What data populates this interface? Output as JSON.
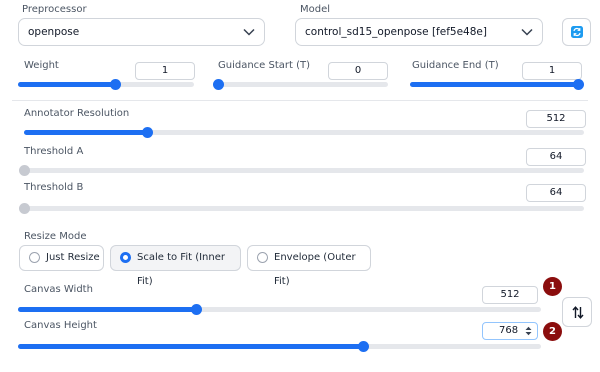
{
  "preprocessor": {
    "label": "Preprocessor",
    "value": "openpose"
  },
  "model": {
    "label": "Model",
    "value": "control_sd15_openpose [fef5e48e]"
  },
  "refresh_icon": "refresh-icon",
  "weight": {
    "label": "Weight",
    "value": "1",
    "fraction": 0.55
  },
  "guidance_start": {
    "label": "Guidance Start (T)",
    "value": "0",
    "fraction": 0.0
  },
  "guidance_end": {
    "label": "Guidance End (T)",
    "value": "1",
    "fraction": 1.0
  },
  "annotator_resolution": {
    "label": "Annotator Resolution",
    "value": "512",
    "fraction": 0.22
  },
  "threshold_a": {
    "label": "Threshold A",
    "value": "64",
    "fraction": 0.0
  },
  "threshold_b": {
    "label": "Threshold B",
    "value": "64",
    "fraction": 0.0
  },
  "resize_mode": {
    "label": "Resize Mode",
    "options": [
      "Just Resize",
      "Scale to Fit (Inner Fit)",
      "Envelope (Outer Fit)"
    ],
    "selected": "Scale to Fit (Inner Fit)"
  },
  "canvas_width": {
    "label": "Canvas Width",
    "value": "512",
    "fraction": 0.34
  },
  "canvas_height": {
    "label": "Canvas Height",
    "value": "768",
    "fraction": 0.66
  },
  "swap_icon": "swap-vertical-arrows-icon",
  "annotations": {
    "badge1": "1",
    "badge2": "2"
  },
  "colors": {
    "accent": "#1d6ff2",
    "badge": "#8b0d0d",
    "refresh": "#1d9bf0"
  }
}
